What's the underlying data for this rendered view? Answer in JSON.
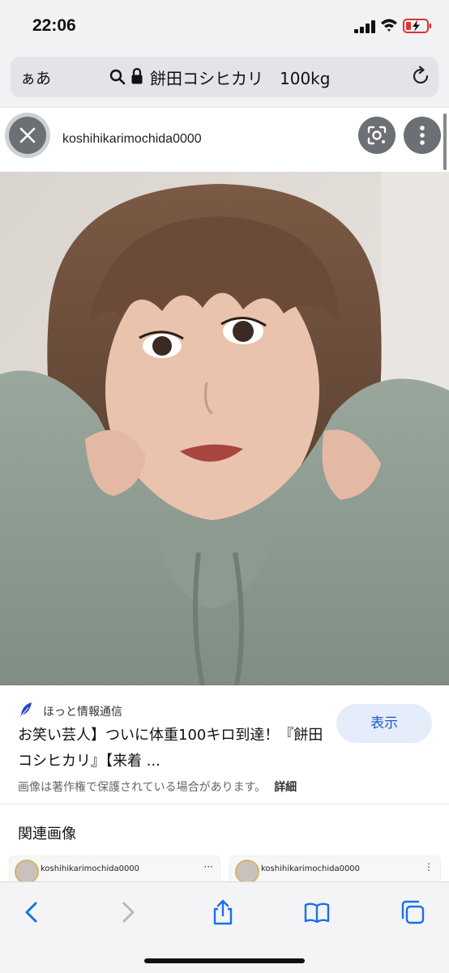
{
  "status_bar": {
    "time": "22:06",
    "battery_charging": true
  },
  "address_bar": {
    "format_label": "ぁあ",
    "query": "餅田コシヒカリ　100kg"
  },
  "viewer": {
    "username": "koshihikarimochida0000"
  },
  "result": {
    "source": "ほっと情報通信",
    "title": "お笑い芸人】ついに体重100キロ到達！『餅田コシヒカリ』【来着 ...",
    "visit_label": "表示",
    "copyright": "画像は著作権で保護されている場合があります。",
    "details_label": "詳細"
  },
  "related": {
    "heading": "関連画像",
    "items": [
      {
        "username": "koshihikarimochida0000",
        "more": "···"
      },
      {
        "username": "koshihikarimochida0000",
        "more": "⋮"
      }
    ]
  },
  "colors": {
    "accent": "#1a56d6",
    "button_bg": "#e6edfa",
    "source_icon": "#1e44c8"
  }
}
